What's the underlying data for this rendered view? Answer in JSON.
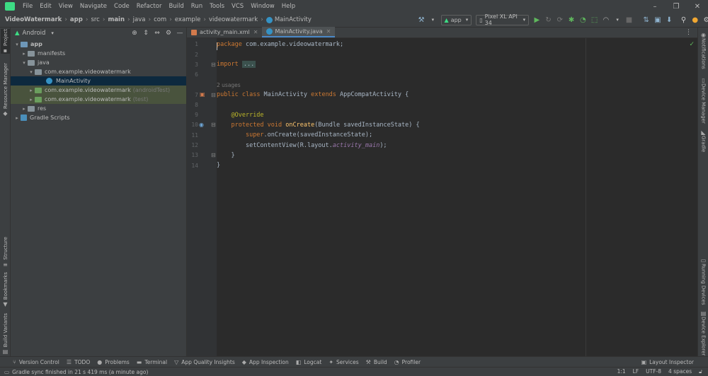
{
  "menu": {
    "items": [
      "File",
      "Edit",
      "View",
      "Navigate",
      "Code",
      "Refactor",
      "Build",
      "Run",
      "Tools",
      "VCS",
      "Window",
      "Help"
    ],
    "window_controls": [
      "–",
      "❐",
      "✕"
    ]
  },
  "breadcrumb": {
    "items": [
      "VideoWatermark",
      "app",
      "src",
      "main",
      "java",
      "com",
      "example",
      "videowatermark"
    ],
    "current": "MainActivity"
  },
  "run_config": {
    "module": "app",
    "device": "Pixel XL API 34"
  },
  "left_tabs": {
    "project": "Project",
    "resource_manager": "Resource Manager",
    "structure": "Structure",
    "bookmarks": "Bookmarks",
    "build_variants": "Build Variants"
  },
  "right_tabs": {
    "notifications": "Notifications",
    "device_manager": "Device Manager",
    "gradle": "Gradle",
    "running_devices": "Running Devices",
    "device_explorer": "Device Explorer"
  },
  "project_panel": {
    "view_mode": "Android",
    "tree": [
      {
        "label": "app",
        "hint": ""
      },
      {
        "label": "manifests",
        "hint": ""
      },
      {
        "label": "java",
        "hint": ""
      },
      {
        "label": "com.example.videowatermark",
        "hint": ""
      },
      {
        "label": "MainActivity",
        "hint": ""
      },
      {
        "label": "com.example.videowatermark",
        "hint": "(androidTest)"
      },
      {
        "label": "com.example.videowatermark",
        "hint": "(test)"
      },
      {
        "label": "res",
        "hint": ""
      },
      {
        "label": "Gradle Scripts",
        "hint": ""
      }
    ]
  },
  "editor": {
    "tabs": [
      {
        "label": "activity_main.xml"
      },
      {
        "label": "MainActivity.java"
      }
    ],
    "line_numbers": [
      "1",
      "2",
      "3",
      "6",
      "7",
      "8",
      "9",
      "10",
      "11",
      "12",
      "13",
      "14"
    ],
    "usages": "2 usages",
    "code": {
      "l1_kw": "package",
      "l1_rest": " com.example.videowatermark;",
      "l3_kw": "import",
      "l3_fold": "...",
      "l7_kw1": "public",
      "l7_kw2": "class",
      "l7_name": " MainActivity ",
      "l7_kw3": "extends",
      "l7_rest": " AppCompatActivity {",
      "l9_ann": "@Override",
      "l10_kw1": "protected",
      "l10_kw2": "void",
      "l10_fn": "onCreate",
      "l10_rest": "(Bundle savedInstanceState) {",
      "l11_kw": "super",
      "l11_rest": ".onCreate(savedInstanceState);",
      "l12_pre": "setContentView(R.layout.",
      "l12_field": "activity_main",
      "l12_post": ");",
      "l13": "}",
      "l14": "}"
    }
  },
  "bottom_tools": [
    "Version Control",
    "TODO",
    "Problems",
    "Terminal",
    "App Quality Insights",
    "App Inspection",
    "Logcat",
    "Services",
    "Build",
    "Profiler"
  ],
  "layout_inspector": "Layout Inspector",
  "status": {
    "message": "Gradle sync finished in 21 s 419 ms (a minute ago)",
    "position": "1:1",
    "line_sep": "LF",
    "encoding": "UTF-8",
    "indent": "4 spaces"
  },
  "colors": {
    "keyword": "#cc7832",
    "annotation": "#bbb529",
    "function": "#ffc66d",
    "field": "#9876aa",
    "accent": "#4a88c7"
  }
}
